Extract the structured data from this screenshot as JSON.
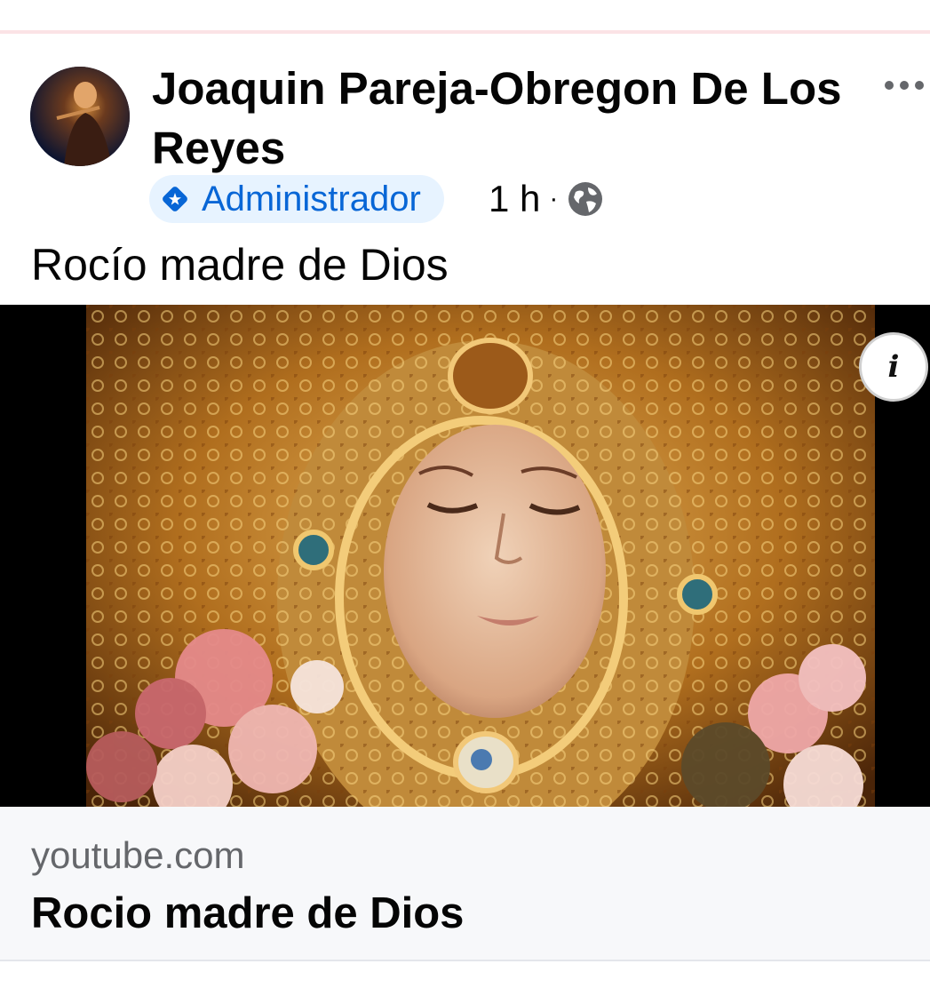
{
  "author": {
    "name": "Joaquin Pareja-Obregon De Los Reyes",
    "role_badge": "Administrador",
    "time": "1 h",
    "separator": "·"
  },
  "post": {
    "text": "Rocío madre de Dios"
  },
  "link_card": {
    "domain": "youtube.com",
    "title": "Rocio madre de Dios"
  },
  "footer_cutoff": {
    "link_text": "",
    "rest_text": ""
  },
  "icons": {
    "more": "more-horizontal-icon",
    "globe": "globe-icon",
    "info": "info-icon",
    "badge": "admin-diamond-icon"
  },
  "colors": {
    "accent": "#0866d6",
    "badge_bg": "#e7f3ff",
    "card_bg": "#f7f8fa",
    "muted": "#65676b"
  }
}
